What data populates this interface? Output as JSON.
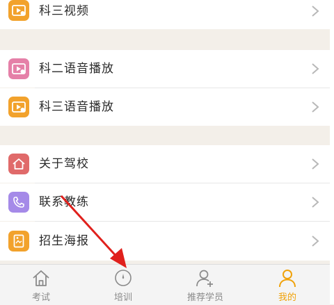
{
  "menu": {
    "items": [
      {
        "label": "科三视频",
        "icon": "video-icon",
        "color": "#f2a22c"
      },
      {
        "label": "科二语音播放",
        "icon": "video-icon",
        "color": "#e580a8"
      },
      {
        "label": "科三语音播放",
        "icon": "video-icon",
        "color": "#f2a22c"
      },
      {
        "label": "关于驾校",
        "icon": "home-icon",
        "color": "#e06a6a"
      },
      {
        "label": "联系教练",
        "icon": "phone-icon",
        "color": "#a58ae8"
      },
      {
        "label": "招生海报",
        "icon": "poster-icon",
        "color": "#f2a22c"
      }
    ]
  },
  "tabbar": {
    "tabs": [
      {
        "label": "考试",
        "icon": "home-outline-icon"
      },
      {
        "label": "培训",
        "icon": "compass-icon"
      },
      {
        "label": "推荐学员",
        "icon": "add-user-icon"
      },
      {
        "label": "我的",
        "icon": "person-icon",
        "active": true
      }
    ],
    "active_color": "#f0a20a",
    "inactive_color": "#8a8a8a"
  },
  "annotation": {
    "color": "#e0201c"
  }
}
